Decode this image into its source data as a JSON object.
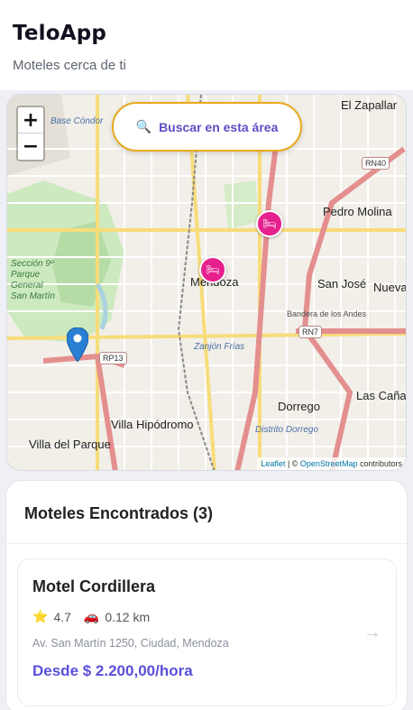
{
  "header": {
    "title": "TeloApp",
    "subtitle": "Moteles cerca de ti"
  },
  "map": {
    "zoom_in": "+",
    "zoom_out": "−",
    "search_area": {
      "icon": "magnifier-icon",
      "glyph": "🔍",
      "label": "Buscar en esta área"
    },
    "labels": {
      "el_zapallar": "El Zapallar",
      "pedro_molina": "Pedro Molina",
      "mendoza": "Mendoza",
      "san_jose": "San José",
      "nueva": "Nueva",
      "dorrego": "Dorrego",
      "las_canas": "Las Cañas",
      "villa_hipodromo": "Villa Hipódromo",
      "villa_del_parque": "Villa del Parque",
      "base_condor": "Base Cóndor",
      "zanjon_frias": "Zanjón Frías",
      "seccion_9": "Sección 9º\nParque General\nSan Martín",
      "distrito_dorrego": "Distrito Dorrego",
      "bandera_andes": "Bandera de los Andes"
    },
    "road_shields": [
      "RN40",
      "RN7",
      "RP13"
    ],
    "attribution": {
      "leaflet": "Leaflet",
      "sep": " | © ",
      "osm": "OpenStreetMap",
      "suffix": " contributors"
    },
    "marker_glyph": "🛏"
  },
  "results": {
    "title": "Moteles Encontrados (3)",
    "items": [
      {
        "name": "Motel Cordillera",
        "rating_icon": "star-icon",
        "rating_glyph": "⭐",
        "rating": "4.7",
        "distance_icon": "car-icon",
        "distance_glyph": "🚗",
        "distance": "0.12 km",
        "address": "Av. San Martín 1250, Ciudad, Mendoza",
        "price": "Desde $ 2.200,00/hora",
        "arrow": "→"
      }
    ]
  },
  "colors": {
    "accent": "#5b4fd9",
    "marker": "#e6218e",
    "search_border": "#e9a81d"
  }
}
